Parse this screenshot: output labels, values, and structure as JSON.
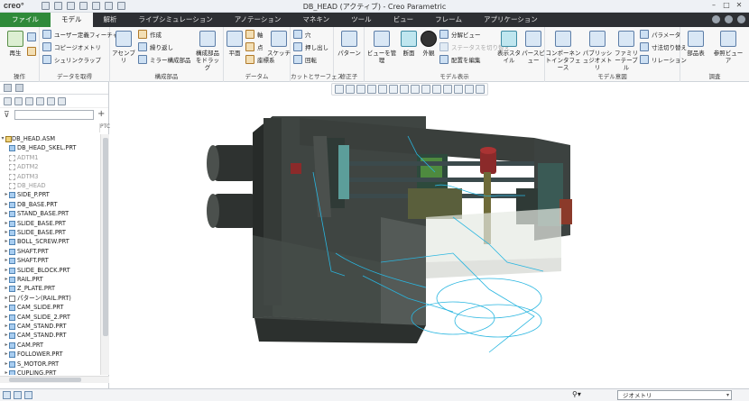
{
  "app": {
    "logo": "creo°",
    "window_title": "DB_HEAD (アクティブ) - Creo Parametric"
  },
  "menu": {
    "tabs": [
      "ファイル",
      "モデル",
      "解析",
      "ライブシミュレーション",
      "アノテーション",
      "マネキン",
      "ツール",
      "ビュー",
      "フレーム",
      "アプリケーション"
    ],
    "active": "モデル"
  },
  "ribbon": {
    "groups": {
      "ops": {
        "label": "操作",
        "regen": "再生"
      },
      "get_data": {
        "label": "データを取得",
        "items": [
          "ユーザー定義フィーチャー",
          "コピージオメトリ",
          "シュリンクラップ"
        ]
      },
      "component": {
        "label": "構成部品",
        "assemble": "アセンブリ",
        "items": [
          "作成",
          "繰り返し",
          "ミラー構成部品"
        ],
        "drag": "構成部品をドラッグ"
      },
      "datum": {
        "label": "データム",
        "plane": "平面",
        "items": [
          "軸",
          "点",
          "座標系"
        ],
        "sketch": "スケッチ"
      },
      "cut_surface": {
        "label": "カットとサーフェス",
        "items": [
          "穴",
          "押し出し",
          "回転"
        ]
      },
      "modifier": {
        "label": "修正子",
        "pattern": "パターン"
      },
      "model_display": {
        "label": "モデル表示",
        "view_manager": "ビューを管理",
        "section": "断面",
        "appearance": "外観",
        "items": [
          "分解ビュー",
          "ステータスを切り替え",
          "配置を編集"
        ],
        "display_style": "表示スタイル",
        "perspective": "パースビュー"
      },
      "model_intent": {
        "label": "モデル意図",
        "component_interface": "コンポーネントインタフェース",
        "publish_geometry": "パブリッシュジオメトリ",
        "family_table": "ファミリーテーブル",
        "items": [
          "パラメータ",
          "寸法切り替え",
          "リレーション"
        ]
      },
      "investigate": {
        "label": "調査",
        "bom": "部品表",
        "reference_viewer": "参照ビューア"
      }
    }
  },
  "model_tree": {
    "filter_placeholder": "",
    "column_header": "PTC",
    "root": "DB_HEAD.ASM",
    "items": [
      {
        "label": "DB_HEAD_SKEL.PRT",
        "type": "part",
        "expandable": false,
        "dim": false
      },
      {
        "label": "ADTM1",
        "type": "datum",
        "expandable": false,
        "dim": true
      },
      {
        "label": "ADTM2",
        "type": "datum",
        "expandable": false,
        "dim": true
      },
      {
        "label": "ADTM3",
        "type": "datum",
        "expandable": false,
        "dim": true
      },
      {
        "label": "DB_HEAD",
        "type": "datum",
        "expandable": false,
        "dim": true
      },
      {
        "label": "SIDE_P.PRT",
        "type": "part",
        "expandable": true,
        "dim": false
      },
      {
        "label": "DB_BASE.PRT",
        "type": "part",
        "expandable": true,
        "dim": false
      },
      {
        "label": "STAND_BASE.PRT",
        "type": "part",
        "expandable": true,
        "dim": false
      },
      {
        "label": "SLIDE_BASE.PRT",
        "type": "part",
        "expandable": true,
        "dim": false
      },
      {
        "label": "SLIDE_BASE.PRT",
        "type": "part",
        "expandable": true,
        "dim": false
      },
      {
        "label": "BOLL_SCREW.PRT",
        "type": "part",
        "expandable": true,
        "dim": false
      },
      {
        "label": "SHAFT.PRT",
        "type": "part",
        "expandable": true,
        "dim": false
      },
      {
        "label": "SHAFT.PRT",
        "type": "part",
        "expandable": true,
        "dim": false
      },
      {
        "label": "SLIDE_BLOCK.PRT",
        "type": "part",
        "expandable": true,
        "dim": false
      },
      {
        "label": "RAIL.PRT",
        "type": "part",
        "expandable": true,
        "dim": false
      },
      {
        "label": "Z_PLATE.PRT",
        "type": "part",
        "expandable": true,
        "dim": false
      },
      {
        "label": "パターン(RAIL.PRT)",
        "type": "pattern",
        "expandable": true,
        "dim": false
      },
      {
        "label": "CAM_SLIDE.PRT",
        "type": "part",
        "expandable": true,
        "dim": false
      },
      {
        "label": "CAM_SLIDE_2.PRT",
        "type": "part",
        "expandable": true,
        "dim": false
      },
      {
        "label": "CAM_STAND.PRT",
        "type": "part",
        "expandable": true,
        "dim": false
      },
      {
        "label": "CAM_STAND.PRT",
        "type": "part",
        "expandable": true,
        "dim": false
      },
      {
        "label": "CAM.PRT",
        "type": "part",
        "expandable": true,
        "dim": false
      },
      {
        "label": "FOLLOWER.PRT",
        "type": "part",
        "expandable": true,
        "dim": false
      },
      {
        "label": "S_MOTOR.PRT",
        "type": "part",
        "expandable": true,
        "dim": false
      },
      {
        "label": "CUPLING.PRT",
        "type": "part",
        "expandable": true,
        "dim": false
      }
    ]
  },
  "status": {
    "selection_filter": "ジオメトリ"
  },
  "colors": {
    "file_tab": "#2f8a3a",
    "menubar": "#2d2f33",
    "model_body": "#3f4542",
    "wireframe": "#29b6e0"
  }
}
